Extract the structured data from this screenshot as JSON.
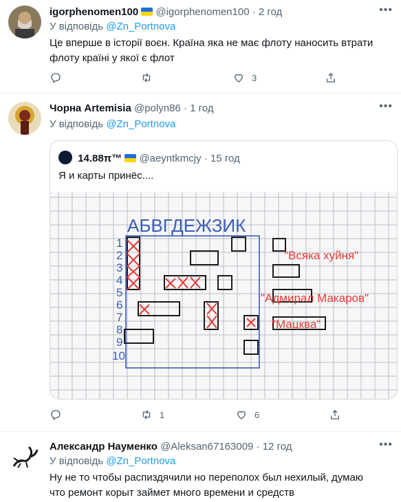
{
  "tweets": [
    {
      "name": "igorphenomen100",
      "handle": "@igorphenomen100",
      "time": "2 год",
      "reply_prefix": "У відповідь",
      "reply_to": "@Zn_Portnova",
      "text": "Це вперше в історії воєн. Країна яка не має флоту наносить втрати флоту країні у якої є флот",
      "likes": "3",
      "retweets": ""
    },
    {
      "name": "Чорна Artemisia",
      "handle": "@polyn86",
      "time": "1 год",
      "reply_prefix": "У відповідь",
      "reply_to": "@Zn_Portnova",
      "retweets": "1",
      "likes": "6",
      "quote": {
        "name": "14.88π™",
        "handle": "@aeyntkmcjy",
        "time": "15 год",
        "text": "Я и карты принёс....",
        "image": {
          "letters": "АБВГДЕЖЗИК",
          "numbers": [
            "1",
            "2",
            "3",
            "4",
            "5",
            "6",
            "7",
            "8",
            "9",
            "10"
          ],
          "labels": [
            "\"Всяка хуйня\"",
            "\"Адмирал Макаров\"",
            "\"Мацква\""
          ]
        }
      }
    },
    {
      "name": "Александр Науменко",
      "handle": "@Aleksan67163009",
      "time": "12 год",
      "reply_prefix": "У відповідь",
      "reply_to": "@Zn_Portnova",
      "text": "Ну не то чтобы распиздячили но переполох был нехилый, думаю что ремонт корыт займет много времени и средств"
    }
  ],
  "colors": {
    "accent": "#1d9bf0",
    "secondary": "#536471",
    "border": "#eff3f4",
    "map_red": "#e53935",
    "map_blue": "#3b5bb5"
  }
}
